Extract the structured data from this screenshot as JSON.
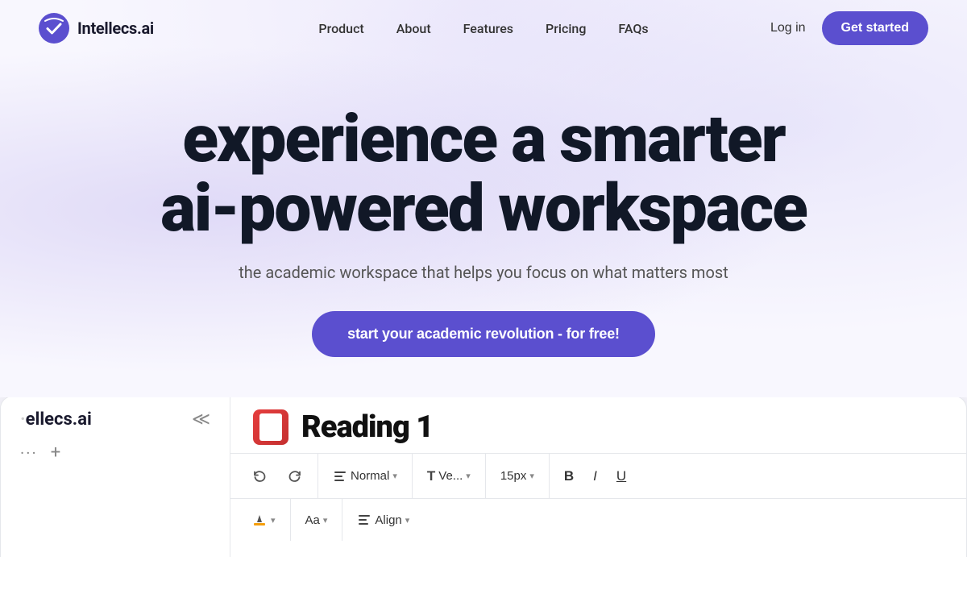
{
  "brand": {
    "name": "Intellecs.ai",
    "logo_alt": "Intellecs.ai logo"
  },
  "nav": {
    "links": [
      {
        "label": "Product",
        "href": "#"
      },
      {
        "label": "About",
        "href": "#"
      },
      {
        "label": "Features",
        "href": "#"
      },
      {
        "label": "Pricing",
        "href": "#"
      },
      {
        "label": "FAQs",
        "href": "#"
      }
    ],
    "login_label": "Log in",
    "get_started_label": "Get started"
  },
  "hero": {
    "title_line1": "experience a smarter",
    "title_line2": "ai-powered workspace",
    "subtitle": "the academic workspace that helps you focus on what matters most",
    "cta_label": "start your academic revolution - for free!"
  },
  "app_preview": {
    "sidebar_logo": "ellecs.ai",
    "doc_title": "Reading 1",
    "toolbar": {
      "normal_label": "Normal",
      "font_label": "Ve...",
      "size_label": "15px",
      "bold": "B",
      "italic": "I",
      "underline": "U",
      "align_label": "Align",
      "aa_label": "Aa"
    }
  },
  "colors": {
    "accent": "#5b4fcf",
    "text_dark": "#111827",
    "text_mid": "#555555"
  }
}
